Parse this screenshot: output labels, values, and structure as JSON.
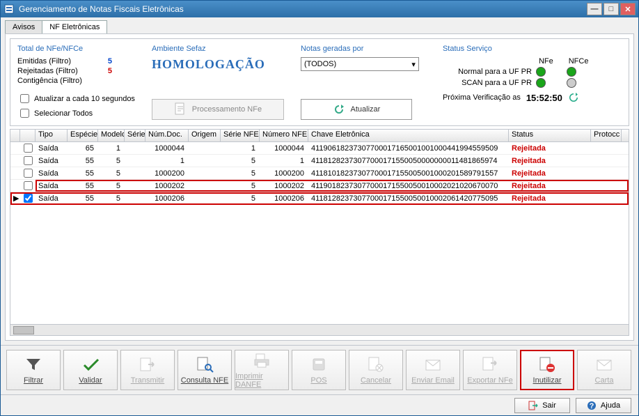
{
  "window": {
    "title": "Gerenciamento de Notas Fiscais Eletrônicas"
  },
  "tabs": {
    "avisos": "Avisos",
    "nfe": "NF Eletrônicas"
  },
  "totals": {
    "heading": "Total de NFe/NFCe",
    "emitidas_lbl": "Emitidas (Filtro)",
    "rejeitadas_lbl": "Rejeitadas (Filtro)",
    "contigencia_lbl": "Contigência (Filtro)",
    "emitidas": "5",
    "rejeitadas": "5",
    "contigencia": ""
  },
  "ambiente": {
    "heading": "Ambiente Sefaz",
    "value": "HOMOLOGAÇÃO"
  },
  "gerador": {
    "heading": "Notas geradas por",
    "selected": "(TODOS)"
  },
  "status": {
    "heading": "Status Serviço",
    "col_nfe": "NFe",
    "col_nfce": "NFCe",
    "row1": "Normal para a UF PR",
    "row2": "SCAN para a UF PR",
    "verify_lbl": "Próxima Verificação as",
    "verify_time": "15:52:50",
    "lights": {
      "r1nfe": "green",
      "r1nfce": "green",
      "r2nfe": "green",
      "r2nfce": "gray"
    }
  },
  "options": {
    "auto_lbl": "Atualizar a cada 10 segundos",
    "selall_lbl": "Selecionar Todos",
    "proc_btn": "Processamento NFe",
    "refresh_btn": "Atualizar"
  },
  "grid": {
    "cols": {
      "tipo": "Tipo",
      "esp": "Espécie",
      "mod": "Modelo",
      "ser": "Série",
      "num": "Núm.Doc.",
      "ori": "Origem",
      "snf": "Série NFE",
      "nnf": "Número NFE",
      "chv": "Chave Eletrônica",
      "sta": "Status",
      "pro": "Protocc"
    },
    "rows": [
      {
        "chk": false,
        "tipo": "Saída",
        "esp": "65",
        "mod": "1",
        "ser": "",
        "num": "1000044",
        "ori": "",
        "snf": "1",
        "nnf": "1000044",
        "chv": "41190618237307700017165001001000441994559509",
        "sta": "Rejeitada"
      },
      {
        "chk": false,
        "tipo": "Saída",
        "esp": "55",
        "mod": "5",
        "ser": "",
        "num": "1",
        "ori": "",
        "snf": "5",
        "nnf": "1",
        "chv": "41181282373077000171550050000000011481865974",
        "sta": "Rejeitada"
      },
      {
        "chk": false,
        "tipo": "Saída",
        "esp": "55",
        "mod": "5",
        "ser": "",
        "num": "1000200",
        "ori": "",
        "snf": "5",
        "nnf": "1000200",
        "chv": "41181018237307700017155005001000201589791557",
        "sta": "Rejeitada"
      },
      {
        "chk": false,
        "tipo": "Saída",
        "esp": "55",
        "mod": "5",
        "ser": "",
        "num": "1000202",
        "ori": "",
        "snf": "5",
        "nnf": "1000202",
        "chv": "41190182373077000171550050010002021020670070",
        "sta": "Rejeitada",
        "hl": true
      },
      {
        "chk": true,
        "tipo": "Saída",
        "esp": "55",
        "mod": "5",
        "ser": "",
        "num": "1000206",
        "ori": "",
        "snf": "5",
        "nnf": "1000206",
        "chv": "41181282373077000171550050010002061420775095",
        "sta": "Rejeitada",
        "sel": true
      }
    ]
  },
  "toolbar": {
    "filtrar": "Filtrar",
    "validar": "Validar",
    "transmitir": "Transmitir",
    "consulta": "Consulta NFE",
    "imprimir": "Imprimir DANFE",
    "pos": "POS",
    "cancelar": "Cancelar",
    "enviar": "Enviar Email",
    "exportar": "Exportar NFe",
    "inutilizar": "Inutilizar",
    "carta": "Carta"
  },
  "footer": {
    "sair": "Sair",
    "ajuda": "Ajuda"
  }
}
